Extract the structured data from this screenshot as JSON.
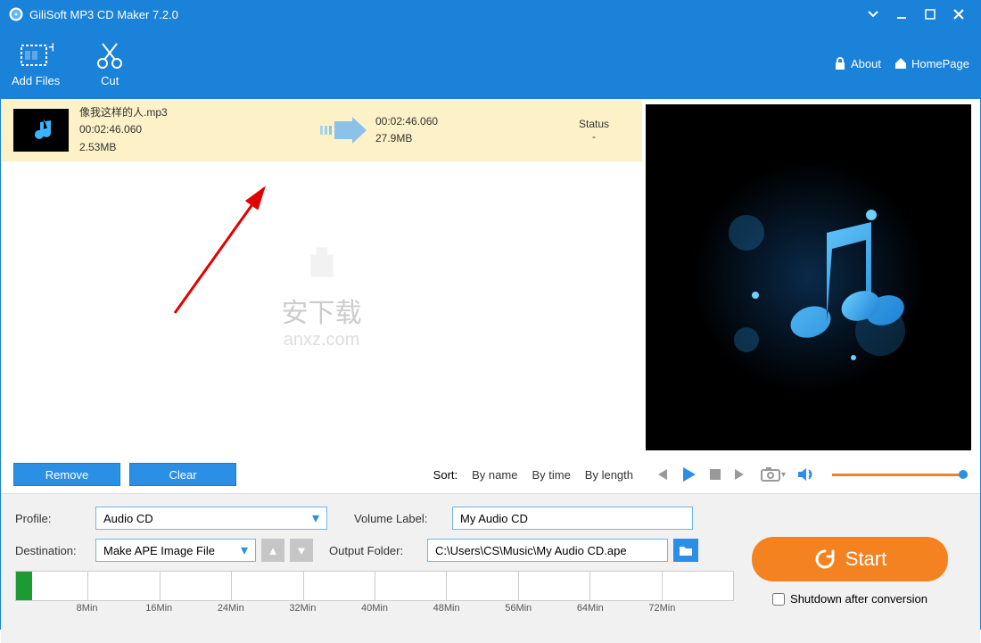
{
  "app": {
    "title": "GiliSoft MP3 CD Maker 7.2.0"
  },
  "toolbar": {
    "add_files": "Add Files",
    "cut": "Cut",
    "about": "About",
    "homepage": "HomePage"
  },
  "file_row": {
    "name": "像我这样的人.mp3",
    "duration": "00:02:46.060",
    "size": "2.53MB",
    "out_duration": "00:02:46.060",
    "out_size": "27.9MB",
    "status_label": "Status",
    "status_value": "-"
  },
  "watermark": {
    "text1": "安下载",
    "text2": "anxz.com"
  },
  "buttons": {
    "remove": "Remove",
    "clear": "Clear"
  },
  "sort": {
    "label": "Sort:",
    "by_name": "By name",
    "by_time": "By time",
    "by_length": "By length"
  },
  "form": {
    "profile_label": "Profile:",
    "profile_value": "Audio CD",
    "destination_label": "Destination:",
    "destination_value": "Make APE Image File",
    "volume_label": "Volume Label:",
    "volume_value": "My Audio CD",
    "output_label": "Output Folder:",
    "output_value": "C:\\Users\\CS\\Music\\My Audio CD.ape"
  },
  "timeline": {
    "ticks": [
      "8Min",
      "16Min",
      "24Min",
      "32Min",
      "40Min",
      "48Min",
      "56Min",
      "64Min",
      "72Min"
    ]
  },
  "start": {
    "label": "Start",
    "shutdown": "Shutdown after conversion"
  }
}
